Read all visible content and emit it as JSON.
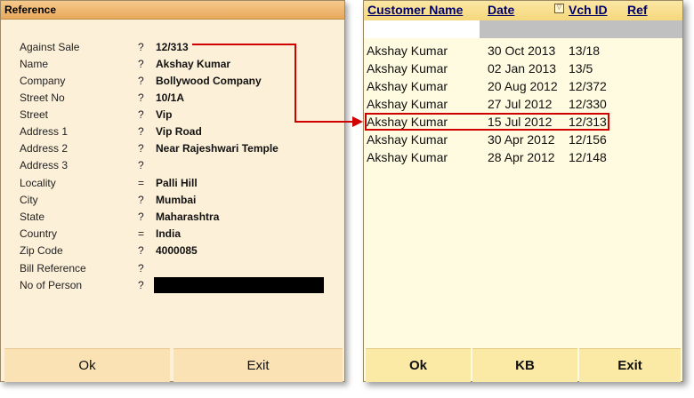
{
  "left": {
    "title": "Reference",
    "fields": [
      {
        "label": "Against Sale",
        "sep": "?",
        "value": "12/313"
      },
      {
        "label": "Name",
        "sep": "?",
        "value": "Akshay Kumar"
      },
      {
        "label": "Company",
        "sep": "?",
        "value": "Bollywood Company"
      },
      {
        "label": "Street No",
        "sep": "?",
        "value": "10/1A"
      },
      {
        "label": "Street",
        "sep": "?",
        "value": "Vip"
      },
      {
        "label": "Address 1",
        "sep": "?",
        "value": "Vip Road"
      },
      {
        "label": "Address 2",
        "sep": "?",
        "value": "Near Rajeshwari Temple"
      },
      {
        "label": "Address 3",
        "sep": "?",
        "value": ""
      },
      {
        "label": "Locality",
        "sep": "=",
        "value": "Palli Hill"
      },
      {
        "label": "City",
        "sep": "?",
        "value": "Mumbai"
      },
      {
        "label": "State",
        "sep": "?",
        "value": "Maharashtra"
      },
      {
        "label": "Country",
        "sep": "=",
        "value": "India"
      },
      {
        "label": "Zip Code",
        "sep": "?",
        "value": "4000085"
      },
      {
        "label": "Bill Reference",
        "sep": "?",
        "value": ""
      },
      {
        "label": "No of Person",
        "sep": "?",
        "value": ""
      }
    ],
    "buttons": {
      "ok": "Ok",
      "exit": "Exit"
    }
  },
  "right": {
    "columns": {
      "customer": "Customer Name",
      "date": "Date",
      "vch": "Vch ID",
      "ref": "Ref"
    },
    "rows": [
      {
        "name": "Akshay Kumar",
        "date": "30 Oct 2013",
        "id": "13/18"
      },
      {
        "name": "Akshay Kumar",
        "date": "02 Jan 2013",
        "id": "13/5"
      },
      {
        "name": "Akshay Kumar",
        "date": "20 Aug 2012",
        "id": "12/372"
      },
      {
        "name": "Akshay Kumar",
        "date": "27 Jul 2012",
        "id": "12/330"
      },
      {
        "name": "Akshay Kumar",
        "date": "15 Jul 2012",
        "id": "12/313"
      },
      {
        "name": "Akshay Kumar",
        "date": "30 Apr 2012",
        "id": "12/156"
      },
      {
        "name": "Akshay Kumar",
        "date": "28 Apr 2012",
        "id": "12/148"
      }
    ],
    "buttons": {
      "ok": "Ok",
      "kb": "KB",
      "exit": "Exit"
    }
  },
  "colors": {
    "annotation": "#d00000",
    "left_bg": "#fdf0d8",
    "right_bg": "#fffbe0"
  }
}
